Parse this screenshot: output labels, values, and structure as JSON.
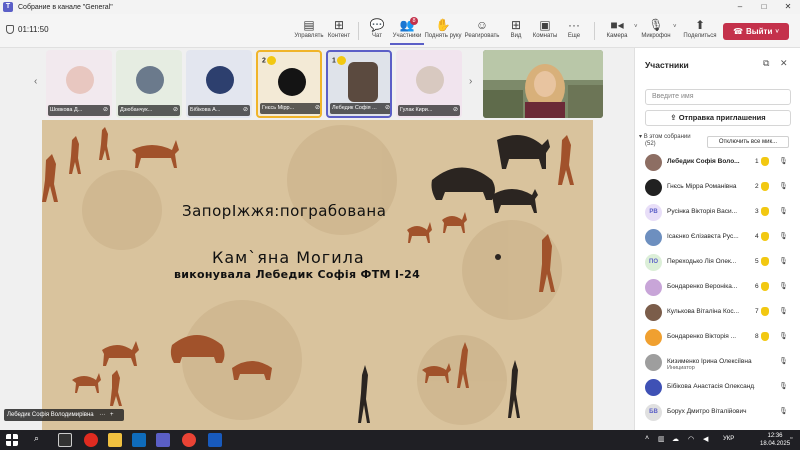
{
  "window": {
    "title": "Собрание в канале \"General\""
  },
  "meeting": {
    "timer": "01:11:50"
  },
  "toolbar": {
    "manage": "Управлять",
    "content": "Контент",
    "chat": "Чат",
    "participants": "Участники",
    "participants_badge": "8",
    "raise_hand": "Поднять руку",
    "react": "Реагировать",
    "view": "Вид",
    "rooms": "Комнаты",
    "more": "Еще",
    "camera": "Камера",
    "mic": "Микрофон",
    "share": "Поделиться",
    "leave": "Выйти"
  },
  "thumbnails": [
    {
      "name": "Шовкова Д...",
      "raise": ""
    },
    {
      "name": "Дзюбанчук...",
      "raise": ""
    },
    {
      "name": "Бібікова А...",
      "raise": ""
    },
    {
      "name": "Гнєсь Мірр...",
      "raise": "2"
    },
    {
      "name": "Лебедик Софія ...",
      "raise": "1"
    },
    {
      "name": "Гулак Кири...",
      "raise": ""
    }
  ],
  "slide": {
    "line1": "ЗапорІжжя:пограбована",
    "line2": "Кам`яна Могила",
    "line3": "виконувала Лебедик Софія ФТМ І-24"
  },
  "speaker": {
    "name": "Лебедик Софія Володимирівна"
  },
  "panel": {
    "title": "Участники",
    "search_placeholder": "Введите имя",
    "invite": "Отправка приглашения",
    "section_label": "В этом собрании",
    "section_count": "(52)",
    "mute_all": "Отключить все мик...",
    "people": [
      {
        "name": "Лебедик Софія Воло...",
        "initials": "",
        "order": "1",
        "hand": true,
        "bold": true,
        "sub": "",
        "color": "#8d6e63"
      },
      {
        "name": "Гнєсь Мірра Романівна",
        "initials": "",
        "order": "2",
        "hand": true,
        "bold": false,
        "sub": "",
        "color": "#212121"
      },
      {
        "name": "Русінка Вікторія Васи...",
        "initials": "РВ",
        "order": "3",
        "hand": true,
        "bold": false,
        "sub": "",
        "color": "#e8def8"
      },
      {
        "name": "Ісаєнко Єлізавєта Рус...",
        "initials": "",
        "order": "4",
        "hand": true,
        "bold": false,
        "sub": "",
        "color": "#6d8fbf"
      },
      {
        "name": "Переходько Лія Олек...",
        "initials": "ПО",
        "order": "5",
        "hand": true,
        "bold": false,
        "sub": "",
        "color": "#dcefd8"
      },
      {
        "name": "Бондаренко Вероніка...",
        "initials": "",
        "order": "6",
        "hand": true,
        "bold": false,
        "sub": "",
        "color": "#c8a5d8"
      },
      {
        "name": "Кулькова Віталіна Кос...",
        "initials": "",
        "order": "7",
        "hand": true,
        "bold": false,
        "sub": "",
        "color": "#7b5d4a"
      },
      {
        "name": "Бондаренко Вікторія ...",
        "initials": "",
        "order": "8",
        "hand": true,
        "bold": false,
        "sub": "",
        "color": "#f0a030"
      },
      {
        "name": "Кизименко Ірина Олексіївна",
        "initials": "",
        "order": "",
        "hand": false,
        "bold": false,
        "sub": "Инициатор",
        "color": "#9e9e9e"
      },
      {
        "name": "Бібікова Анастасія Олександ...",
        "initials": "",
        "order": "",
        "hand": false,
        "bold": false,
        "sub": "",
        "color": "#3f51b5"
      },
      {
        "name": "Борух Дмитро Віталійович",
        "initials": "БВ",
        "order": "",
        "hand": false,
        "bold": false,
        "sub": "",
        "color": "#e0e0e0"
      }
    ]
  },
  "taskbar": {
    "time": "12:36",
    "date": "18.04.2025",
    "lang": "УКР"
  }
}
